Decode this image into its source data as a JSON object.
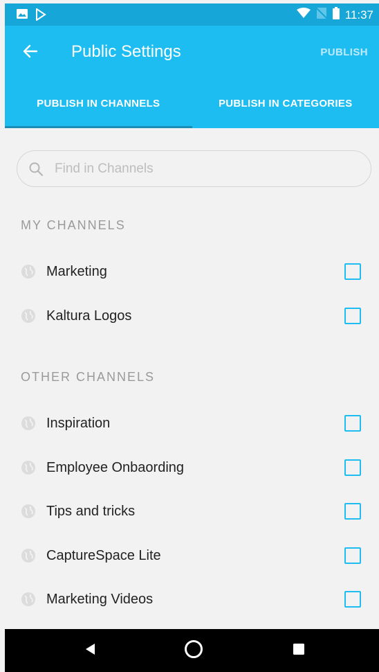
{
  "status_bar": {
    "time": "11:37",
    "icons": [
      "image-icon",
      "play-store-icon",
      "wifi-icon",
      "no-signal-icon",
      "battery-icon"
    ]
  },
  "appbar": {
    "title": "Public Settings",
    "back_icon": "arrow-back-icon",
    "publish_label": "PUBLISH"
  },
  "tabs": [
    {
      "label": "PUBLISH IN CHANNELS",
      "active": true
    },
    {
      "label": "PUBLISH IN CATEGORIES",
      "active": false
    }
  ],
  "search": {
    "placeholder": "Find in Channels",
    "value": ""
  },
  "sections": {
    "my_channels": {
      "title": "MY CHANNELS",
      "items": [
        {
          "label": "Marketing",
          "checked": false
        },
        {
          "label": "Kaltura Logos",
          "checked": false
        }
      ]
    },
    "other_channels": {
      "title": "OTHER CHANNELS",
      "items": [
        {
          "label": "Inspiration",
          "checked": false
        },
        {
          "label": "Employee Onbaording",
          "checked": false
        },
        {
          "label": "Tips and tricks",
          "checked": false
        },
        {
          "label": "CaptureSpace Lite",
          "checked": false
        },
        {
          "label": "Marketing Videos",
          "checked": false
        }
      ]
    }
  },
  "colors": {
    "accent": "#1ebdf1",
    "status_bar": "#16a6d8",
    "tab_indicator": "#1a8cb5",
    "background": "#f2f2f2"
  },
  "nav_bar": {
    "buttons": [
      "back-triangle-icon",
      "home-circle-icon",
      "recents-square-icon"
    ]
  }
}
